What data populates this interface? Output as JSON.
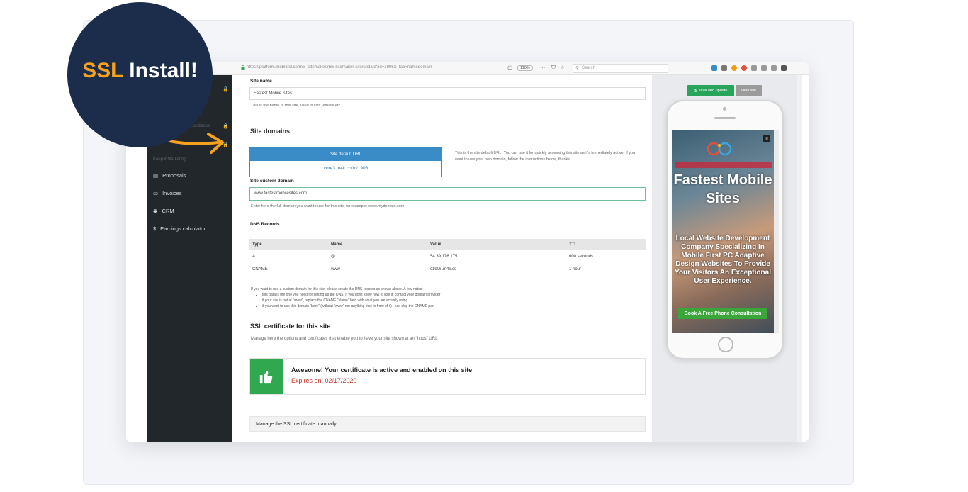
{
  "badge": {
    "part1": "SSL",
    "part2": "Install!"
  },
  "browser": {
    "url": "https://platform.mobifirst.co/mw_sitemaker/mw-sitemaker-site/update?id=1906&_tab=namedomain",
    "zoom": "110%",
    "search_placeholder": "Search"
  },
  "sidebar": {
    "items": [
      {
        "label": "Proposals",
        "icon": "file-icon"
      },
      {
        "label": "Invoices",
        "icon": "invoice-icon"
      },
      {
        "label": "CRM",
        "icon": "eye-icon"
      },
      {
        "label": "Earnings calculator",
        "icon": "dollar-icon"
      }
    ],
    "partial_1": "...outbacks",
    "partial_2": "Keep it Marketing"
  },
  "form": {
    "site_name_label": "Site name",
    "site_name_value": "Fastest Mobile Sites",
    "site_name_hint": "This is the name of this site, used in lists, emails etc.",
    "domains_title": "Site domains",
    "default_url_label": "Site default URL",
    "default_url_value": "core3.m4k.co/m/1906",
    "default_url_hint": "This is the site default URL. You can use it for quickly accessing this site as it's immediately active. If you want to use your own domain, follow the instructions below, thanks!",
    "custom_domain_label": "Site custom domain",
    "custom_domain_value": "www.fastestmobilesites.com",
    "custom_domain_hint": "Enter here the full domain you want to use for this site, for example: www.mydomain.com"
  },
  "dns": {
    "title": "DNS Records",
    "headers": [
      "Type",
      "Name",
      "Value",
      "TTL"
    ],
    "rows": [
      [
        "A",
        "@",
        "54.39.176.175",
        "600 seconds"
      ],
      [
        "CNAME",
        "www",
        "c1906.m4k.co",
        "1 hour"
      ]
    ],
    "notes_intro": "If you want to use a custom domain for this site, please create the DNS records as shown above. A few notes:",
    "notes": [
      "this data is the one you need for setting up the DNS. If you don't know how to use it, contact your domain provider",
      "if your site is not at \"www\", replace the CNAME \"Name\" field with what you are actually using",
      "if you want to use this domain \"bare\" (without \"www\" nor anything else in front of it) - just skip the CNAME part"
    ]
  },
  "ssl": {
    "title": "SSL certificate for this site",
    "hint": "Manage here the options and certificates that enable you to have your site shown at an \"https\" URL",
    "status_title": "Awesome! Your certificate is active and enabled on this site",
    "expires": "Expires on: 02/17/2020",
    "manual": "Manage the SSL certificate manually"
  },
  "preview": {
    "save_label": "save and update",
    "view_label": "view site",
    "phone_title": "Fastest Mobile Sites",
    "phone_sub": "Local Website Development Company Specializing In Mobile First PC Adaptive Design Websites To Provide Your Visitors An Exceptional User Experience.",
    "phone_cta": "Book A Free Phone Consultation"
  },
  "colors": {
    "badge_bg": "#1b2d4a",
    "badge_accent": "#f6a21e",
    "primary_blue": "#3a8cc7",
    "success_green": "#2fa84f",
    "danger_red": "#c0392b"
  }
}
